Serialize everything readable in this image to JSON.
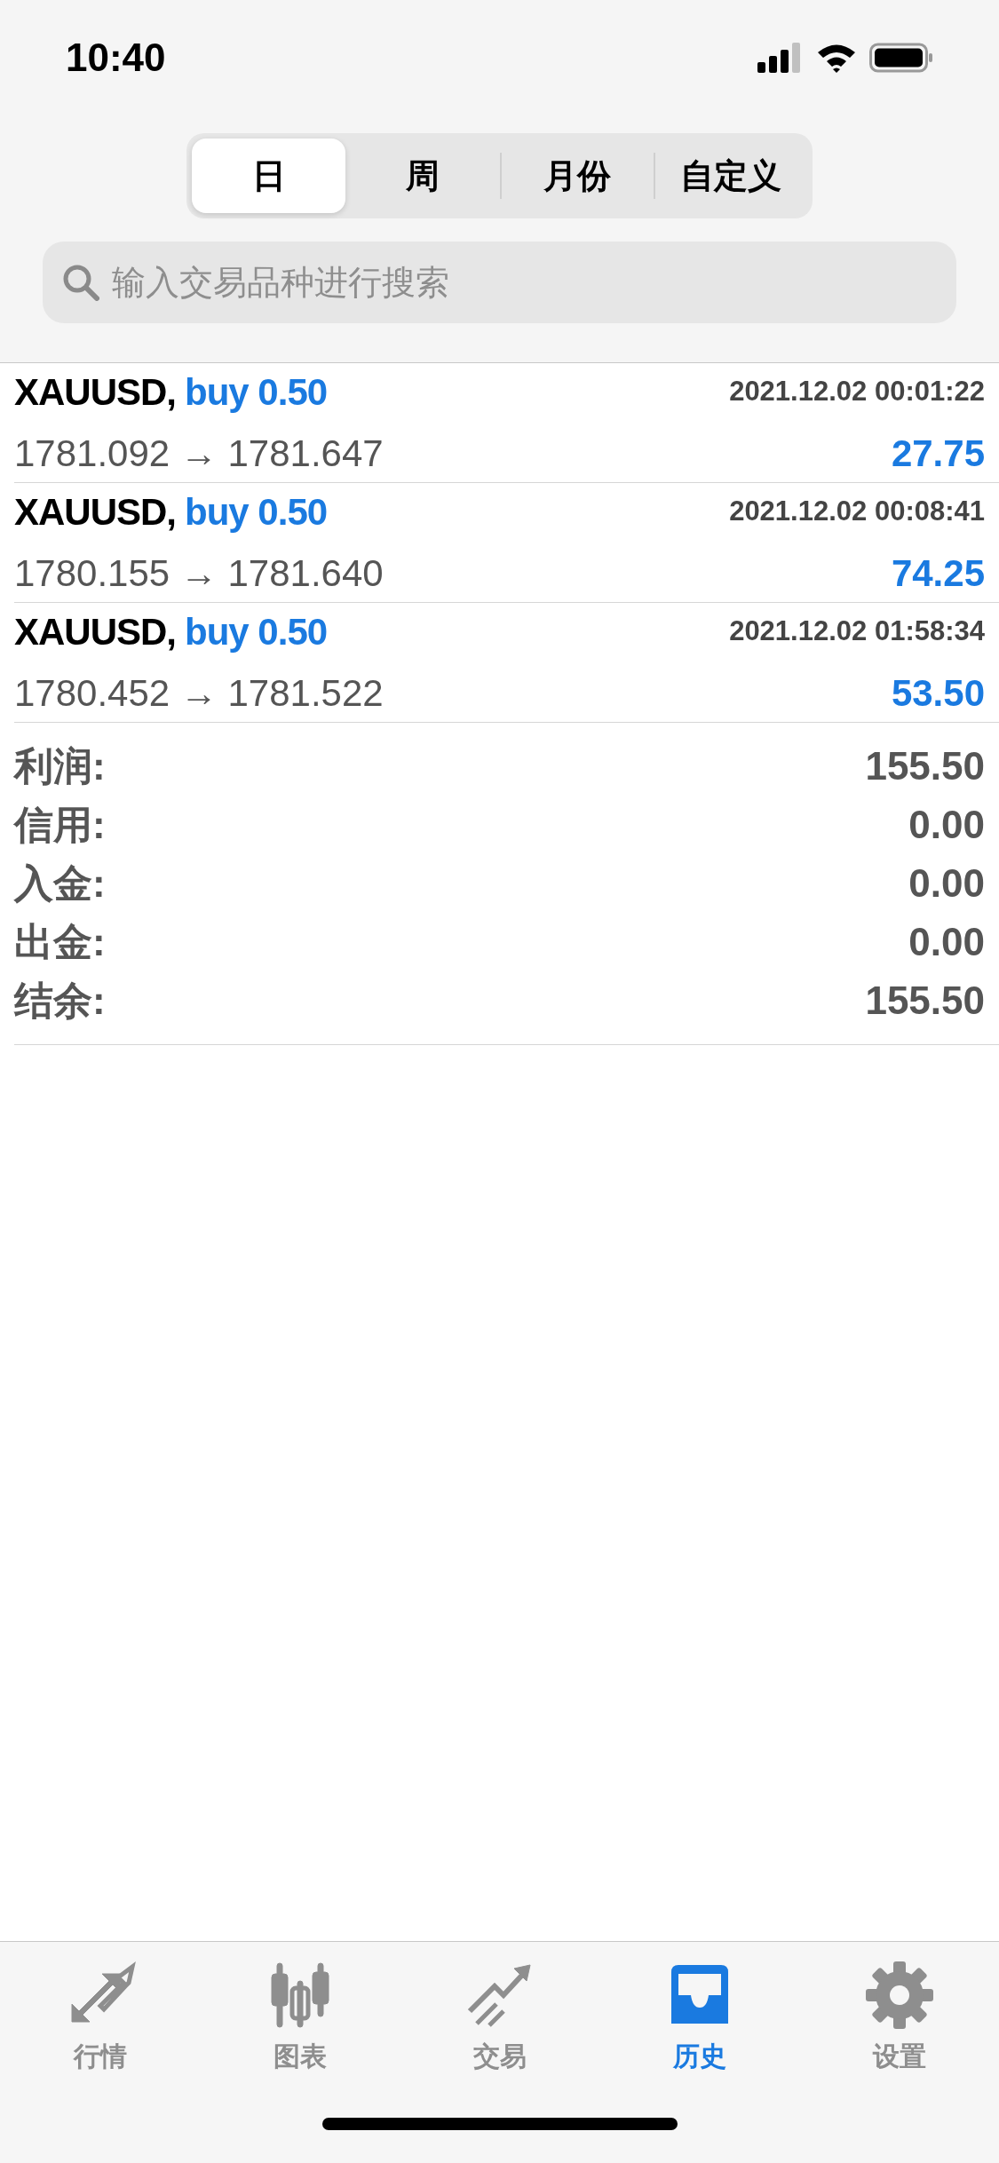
{
  "status_bar": {
    "time": "10:40"
  },
  "period_tabs": [
    {
      "label": "日",
      "selected": true
    },
    {
      "label": "周",
      "selected": false
    },
    {
      "label": "月份",
      "selected": false
    },
    {
      "label": "自定义",
      "selected": false
    }
  ],
  "search": {
    "placeholder": "输入交易品种进行搜索"
  },
  "deals": [
    {
      "symbol": "XAUUSD,",
      "side": "buy 0.50",
      "time": "2021.12.02 00:01:22",
      "prices": "1781.092 → 1781.647",
      "profit": "27.75"
    },
    {
      "symbol": "XAUUSD,",
      "side": "buy 0.50",
      "time": "2021.12.02 00:08:41",
      "prices": "1780.155 → 1781.640",
      "profit": "74.25"
    },
    {
      "symbol": "XAUUSD,",
      "side": "buy 0.50",
      "time": "2021.12.02 01:58:34",
      "prices": "1780.452 → 1781.522",
      "profit": "53.50"
    }
  ],
  "summary": [
    {
      "label": "利润:",
      "value": "155.50"
    },
    {
      "label": "信用:",
      "value": "0.00"
    },
    {
      "label": "入金:",
      "value": "0.00"
    },
    {
      "label": "出金:",
      "value": "0.00"
    },
    {
      "label": "结余:",
      "value": "155.50"
    }
  ],
  "tab_bar": [
    {
      "label": "行情",
      "selected": false
    },
    {
      "label": "图表",
      "selected": false
    },
    {
      "label": "交易",
      "selected": false
    },
    {
      "label": "历史",
      "selected": true
    },
    {
      "label": "设置",
      "selected": false
    }
  ]
}
